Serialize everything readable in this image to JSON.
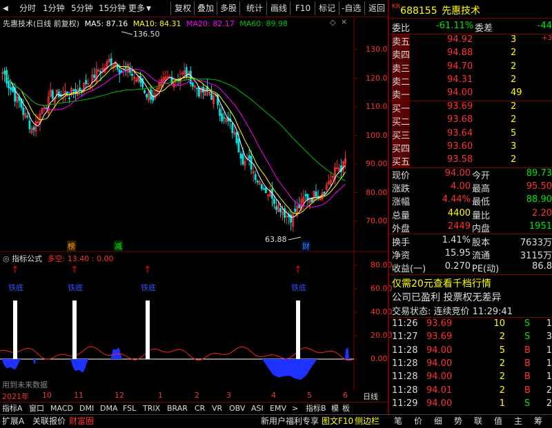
{
  "toolbar": {
    "left_items": [
      "分时",
      "1分钟",
      "5分钟",
      "15分钟",
      "更多"
    ],
    "right_items": [
      "复权",
      "叠加",
      "多股",
      "统计",
      "画线",
      "F10",
      "标记",
      "-自选",
      "返回"
    ]
  },
  "main_legend": {
    "title": "先惠技术(日线 前复权)",
    "ma5": "MA5: 87.16",
    "ma10": "MA10: 84.31",
    "ma20": "MA20: 82.17",
    "ma60": "MA60: 89.98"
  },
  "price_axis": {
    "labels": [
      "130.0",
      "120.0",
      "110.0",
      "100.0",
      "90.00",
      "80.00",
      "70.00"
    ]
  },
  "annotations": {
    "high": "136.50",
    "low": "63.88",
    "tag_bang": "榜",
    "tag_jian": "减",
    "tag_cai": "财"
  },
  "indicator": {
    "name": "指标公式",
    "label": "多空: 13.40 : 0.00",
    "axis": [
      "80.00",
      "60.00",
      "40.00",
      "20.00",
      "0.00"
    ],
    "bottom_label": "铁底",
    "warning": "用到未来数据"
  },
  "date_axis": {
    "labels": [
      "2021年",
      "10",
      "11",
      "12",
      "1",
      "2",
      "3",
      "4",
      "5",
      "6"
    ],
    "right_label": "日线"
  },
  "tabs": [
    "指标A",
    "窗口",
    "MACD",
    "DMI",
    "DMA",
    "FSL",
    "TRIX",
    "BRAR",
    "CR",
    "VR",
    "OBV",
    "ASI",
    "EMV",
    ">",
    "指标B",
    "模",
    "板"
  ],
  "statusbar": {
    "left": [
      "扩展A",
      "关联报价",
      "财富圈"
    ],
    "middle": [
      "新用户福利专享",
      "图文F10",
      "侧边栏"
    ],
    "right": [
      "笔",
      "价",
      "细",
      "势",
      "联",
      "值",
      "主",
      "筹"
    ]
  },
  "quote": {
    "code": "688155",
    "name": "先惠技术",
    "kr": "KR",
    "weibi_label": "委比",
    "weibi": "-61.11%",
    "weicha_label": "委差",
    "weicha": "-44",
    "sell": [
      {
        "label": "卖五",
        "price": "94.92",
        "vol": "3",
        "chg": "+3"
      },
      {
        "label": "卖四",
        "price": "94.88",
        "vol": "2",
        "chg": ""
      },
      {
        "label": "卖三",
        "price": "94.70",
        "vol": "2",
        "chg": ""
      },
      {
        "label": "卖二",
        "price": "94.31",
        "vol": "2",
        "chg": ""
      },
      {
        "label": "卖一",
        "price": "94.00",
        "vol": "49",
        "chg": ""
      }
    ],
    "buy": [
      {
        "label": "买一",
        "price": "93.69",
        "vol": "2"
      },
      {
        "label": "买二",
        "price": "93.68",
        "vol": "2"
      },
      {
        "label": "买三",
        "price": "93.64",
        "vol": "5"
      },
      {
        "label": "买四",
        "price": "93.60",
        "vol": "3"
      },
      {
        "label": "买五",
        "price": "93.58",
        "vol": "2"
      }
    ],
    "stats": [
      {
        "l1": "现价",
        "v1": "94.00",
        "l2": "今开",
        "v2": "89.73"
      },
      {
        "l1": "涨跌",
        "v1": "4.00",
        "l2": "最高",
        "v2": "95.50"
      },
      {
        "l1": "涨幅",
        "v1": "4.44%",
        "l2": "最低",
        "v2": "88.90"
      },
      {
        "l1": "总量",
        "v1": "4400",
        "l2": "量比",
        "v2": "2.20"
      },
      {
        "l1": "外盘",
        "v1": "2449",
        "l2": "内盘",
        "v2": "1951"
      }
    ],
    "stats2": [
      {
        "l1": "换手",
        "v1": "1.41%",
        "l2": "股本",
        "v2": "7633万"
      },
      {
        "l1": "净资",
        "v1": "15.95",
        "l2": "流通",
        "v2": "3115万"
      },
      {
        "l1": "收益(一)",
        "v1": "0.270",
        "l2": "PE(动)",
        "v2": "86.8"
      }
    ],
    "promo": "仅需20元查看千档行情",
    "notice": "公司已盈利 投票权无差异",
    "trade_status": "交易状态: 连续竞价 11:29:41",
    "ticks": [
      {
        "time": "11:26",
        "price": "93.69",
        "vol": "10",
        "bs": "S",
        "n": "1"
      },
      {
        "time": "11:27",
        "price": "93.69",
        "vol": "2",
        "bs": "S",
        "n": "3"
      },
      {
        "time": "11:28",
        "price": "94.00",
        "vol": "5",
        "bs": "B",
        "n": "1"
      },
      {
        "time": "11:28",
        "price": "94.00",
        "vol": "2",
        "bs": "B",
        "n": "1"
      },
      {
        "time": "11:28",
        "price": "94.00",
        "vol": "2",
        "bs": "B",
        "n": "1"
      },
      {
        "time": "11:28",
        "price": "94.01",
        "vol": "2",
        "bs": "B",
        "n": "2"
      },
      {
        "time": "11:29",
        "price": "94.00",
        "vol": "1",
        "bs": "S",
        "n": "2"
      }
    ]
  },
  "colors": {
    "up": "#ff3232",
    "down": "#00e0e0",
    "ma5": "#ffffff",
    "ma10": "#ffff00",
    "ma20": "#ff00ff",
    "ma60": "#00c000",
    "border": "#7a0000"
  }
}
